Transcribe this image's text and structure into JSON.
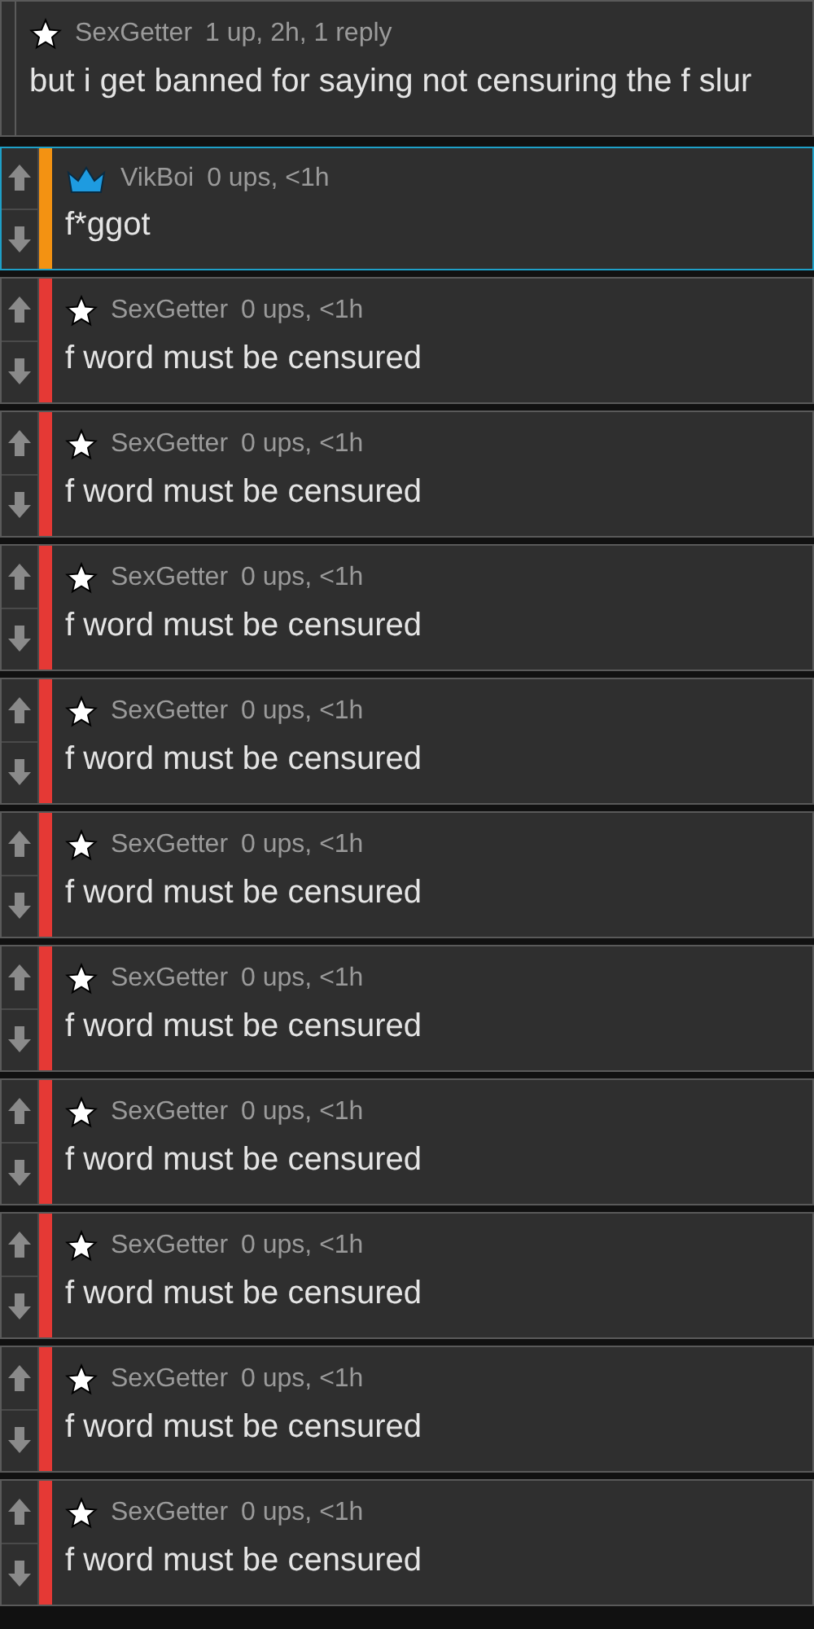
{
  "comments": [
    {
      "kind": "parent",
      "crown": false,
      "user": "SexGetter",
      "meta": "1 up, 2h, 1 reply",
      "text": "but i get banned for saying not censuring the f slur",
      "highlighted": false
    },
    {
      "kind": "reply",
      "crown": true,
      "user": "VikBoi",
      "meta": "0 ups, <1h",
      "text": "f*ggot",
      "color": "#f39212",
      "highlighted": true
    },
    {
      "kind": "reply",
      "crown": false,
      "user": "SexGetter",
      "meta": "0 ups, <1h",
      "text": "f word must be censured",
      "color": "#e53935",
      "highlighted": false
    },
    {
      "kind": "reply",
      "crown": false,
      "user": "SexGetter",
      "meta": "0 ups, <1h",
      "text": "f word must be censured",
      "color": "#e53935",
      "highlighted": false
    },
    {
      "kind": "reply",
      "crown": false,
      "user": "SexGetter",
      "meta": "0 ups, <1h",
      "text": "f word must be censured",
      "color": "#e53935",
      "highlighted": false
    },
    {
      "kind": "reply",
      "crown": false,
      "user": "SexGetter",
      "meta": "0 ups, <1h",
      "text": "f word must be censured",
      "color": "#e53935",
      "highlighted": false
    },
    {
      "kind": "reply",
      "crown": false,
      "user": "SexGetter",
      "meta": "0 ups, <1h",
      "text": "f word must be censured",
      "color": "#e53935",
      "highlighted": false
    },
    {
      "kind": "reply",
      "crown": false,
      "user": "SexGetter",
      "meta": "0 ups, <1h",
      "text": "f word must be censured",
      "color": "#e53935",
      "highlighted": false
    },
    {
      "kind": "reply",
      "crown": false,
      "user": "SexGetter",
      "meta": "0 ups, <1h",
      "text": "f word must be censured",
      "color": "#e53935",
      "highlighted": false
    },
    {
      "kind": "reply",
      "crown": false,
      "user": "SexGetter",
      "meta": "0 ups, <1h",
      "text": "f word must be censured",
      "color": "#e53935",
      "highlighted": false
    },
    {
      "kind": "reply",
      "crown": false,
      "user": "SexGetter",
      "meta": "0 ups, <1h",
      "text": "f word must be censured",
      "color": "#e53935",
      "highlighted": false
    },
    {
      "kind": "reply",
      "crown": false,
      "user": "SexGetter",
      "meta": "0 ups, <1h",
      "text": "f word must be censured",
      "color": "#e53935",
      "highlighted": false
    }
  ]
}
